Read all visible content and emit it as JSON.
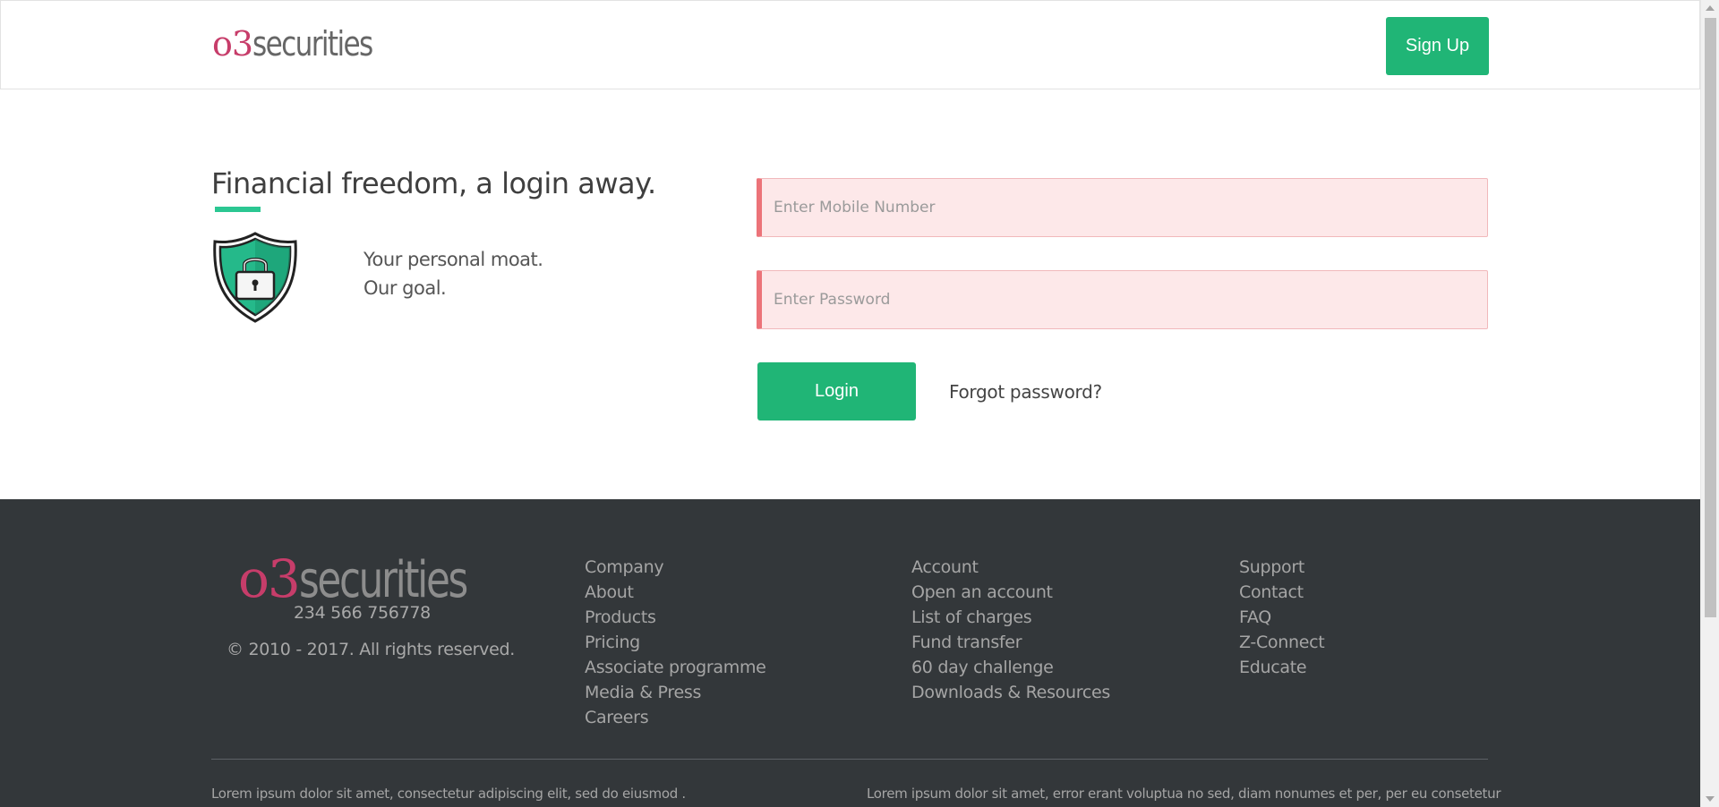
{
  "header": {
    "logo_o3": "o3",
    "logo_securities": "securities",
    "signup_label": "Sign Up"
  },
  "main": {
    "headline": "Financial freedom, a login away.",
    "tagline_line1": "Your personal moat.",
    "tagline_line2": "Our goal.",
    "mobile_placeholder": "Enter Mobile Number",
    "password_placeholder": "Enter Password",
    "login_label": "Login",
    "forgot_label": "Forgot password?"
  },
  "footer": {
    "logo_o3": "o3",
    "logo_securities": "securities",
    "phone": "234 566 756778",
    "copyright": "© 2010 - 2017. All rights reserved.",
    "columns": [
      [
        "Company",
        "About",
        "Products",
        "Pricing",
        "Associate programme",
        "Media & Press",
        "Careers"
      ],
      [
        "Account",
        "Open an account",
        "List of charges",
        "Fund transfer",
        "60 day challenge",
        "Downloads & Resources"
      ],
      [
        "Support",
        "Contact",
        "FAQ",
        "Z-Connect",
        "Educate"
      ]
    ],
    "lorem_left": "Lorem ipsum dolor sit amet, consectetur adipiscing elit, sed do eiusmod .",
    "lorem_right": "Lorem ipsum dolor sit amet, error erant voluptua no sed, diam nonumes et per, per eu consetetur"
  },
  "colors": {
    "brand_green": "#20b576",
    "brand_pink": "#c73d6a",
    "error_bg": "#fde8e9",
    "error_border": "#ec7379",
    "footer_bg": "#33373a"
  },
  "icons": {
    "shield": "shield-lock-icon"
  }
}
